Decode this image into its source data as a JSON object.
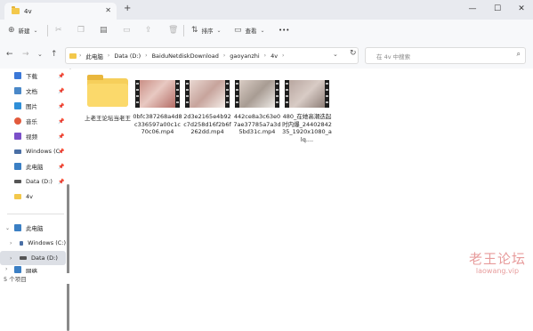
{
  "window": {
    "tab_title": "4v",
    "tab_close": "✕",
    "new_tab": "+",
    "minimize": "—",
    "maximize": "☐",
    "close": "✕"
  },
  "toolbar": {
    "new_label": "新建",
    "sort_label": "排序",
    "view_label": "查看",
    "more": "•••"
  },
  "address": {
    "crumbs": [
      "此电脑",
      "Data (D:)",
      "BaiduNetdiskDownload",
      "gaoyanzhi",
      "4v"
    ],
    "search_placeholder": "在 4v 中搜索"
  },
  "sidebar": {
    "quick": [
      {
        "label": "下载",
        "color": "#3b78d8"
      },
      {
        "label": "文档",
        "color": "#4a88c8"
      },
      {
        "label": "图片",
        "color": "#2f8fd8"
      },
      {
        "label": "音乐",
        "color": "#e25a3c"
      },
      {
        "label": "视频",
        "color": "#7b4fc9"
      },
      {
        "label": "Windows (C",
        "color": "#4a6fa5"
      },
      {
        "label": "此电脑",
        "color": "#3b7fc4"
      },
      {
        "label": "Data (D:)",
        "color": "#555555"
      },
      {
        "label": "4v",
        "color": "#f3c84b"
      }
    ],
    "tree": [
      {
        "label": "此电脑",
        "color": "#3b7fc4"
      },
      {
        "label": "Windows (C:)",
        "color": "#4a6fa5"
      },
      {
        "label": "Data (D:)",
        "color": "#555555"
      },
      {
        "label": "网络",
        "color": "#3b7fc4"
      }
    ]
  },
  "files": [
    {
      "name": "上老王论坛当老王",
      "type": "folder"
    },
    {
      "name": "0bfc387268a4d8c336597a00c1c70c06.mp4",
      "type": "video",
      "colors": [
        "#c98f86",
        "#e8c9c2",
        "#b46d66"
      ]
    },
    {
      "name": "2d3e2165e4b92c7d258d16f2b6f262dd.mp4",
      "type": "video",
      "colors": [
        "#e9d8d2",
        "#c7a49c",
        "#f4ece8"
      ]
    },
    {
      "name": "442ce8a3c63e07ae37785a7a3d5bd31c.mp4",
      "type": "video",
      "colors": [
        "#d9ccc4",
        "#a89c93",
        "#eeeae6"
      ]
    },
    {
      "name": "480_在她高潮迭起时内爆_2440284235_1920x1080_alq....",
      "type": "video",
      "colors": [
        "#b8a7a0",
        "#d8cbc5",
        "#8e7f78"
      ]
    }
  ],
  "status": {
    "count_text": "5 个项目"
  },
  "watermark": {
    "line1": "老王论坛",
    "line2": "laowang.vip"
  }
}
